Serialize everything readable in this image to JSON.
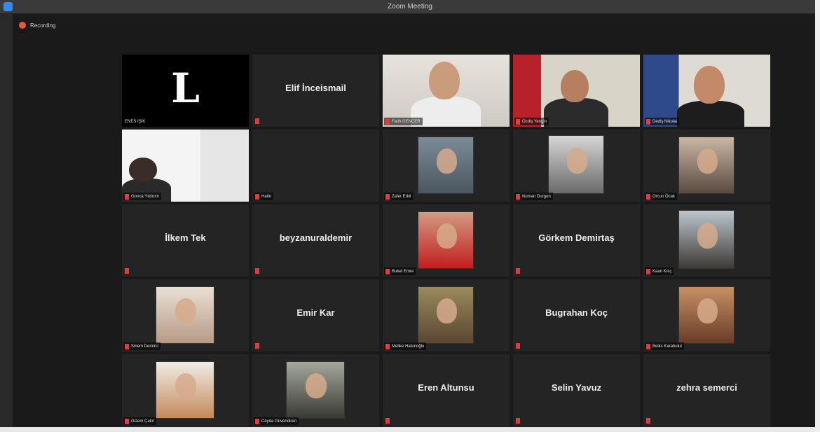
{
  "window": {
    "title": "Zoom Meeting",
    "recording_label": "Recording"
  },
  "colors": {
    "background": "#1a1a1a",
    "tile": "#242424",
    "active_speaker_border": "#b5d36b",
    "muted": "#e23b3b",
    "recording": "#e8573a"
  },
  "participants": [
    {
      "name": "ENES IŞIK",
      "video": "logo",
      "logo_text": "L"
    },
    {
      "name": "Elif İnceismail",
      "video": "off"
    },
    {
      "name": "Fatih GENCER",
      "video": "on"
    },
    {
      "name": "Özdiş Yengin",
      "video": "on",
      "active": true
    },
    {
      "name": "Dediş Nikolai",
      "video": "on"
    },
    {
      "name": "Gonca Yıldırım",
      "video": "on"
    },
    {
      "name": "Hatin",
      "video": "off",
      "hide_center": true
    },
    {
      "name": "Zafer Erkil",
      "video": "photo"
    },
    {
      "name": "Numan Durgun",
      "video": "photo"
    },
    {
      "name": "Orcun Öcak",
      "video": "photo"
    },
    {
      "name": "İlkem Tek",
      "video": "off"
    },
    {
      "name": "beyzanuraldemir",
      "video": "off"
    },
    {
      "name": "Buket Emre",
      "video": "photo"
    },
    {
      "name": "Görkem Demirtaş",
      "video": "off"
    },
    {
      "name": "Kaan Kılıç",
      "video": "photo"
    },
    {
      "name": "Sinem Demirci",
      "video": "photo"
    },
    {
      "name": "Emir Kar",
      "video": "off"
    },
    {
      "name": "Melike Hatunoğlu",
      "video": "photo"
    },
    {
      "name": "Bugrahan Koç",
      "video": "off"
    },
    {
      "name": "Belks Karabulut",
      "video": "photo"
    },
    {
      "name": "Gizem Çakır",
      "video": "photo"
    },
    {
      "name": "Ceyda Güvendiren",
      "video": "photo"
    },
    {
      "name": "Eren Altunsu",
      "video": "off"
    },
    {
      "name": "Selin Yavuz",
      "video": "off"
    },
    {
      "name": "zehra semerci",
      "video": "off"
    }
  ]
}
